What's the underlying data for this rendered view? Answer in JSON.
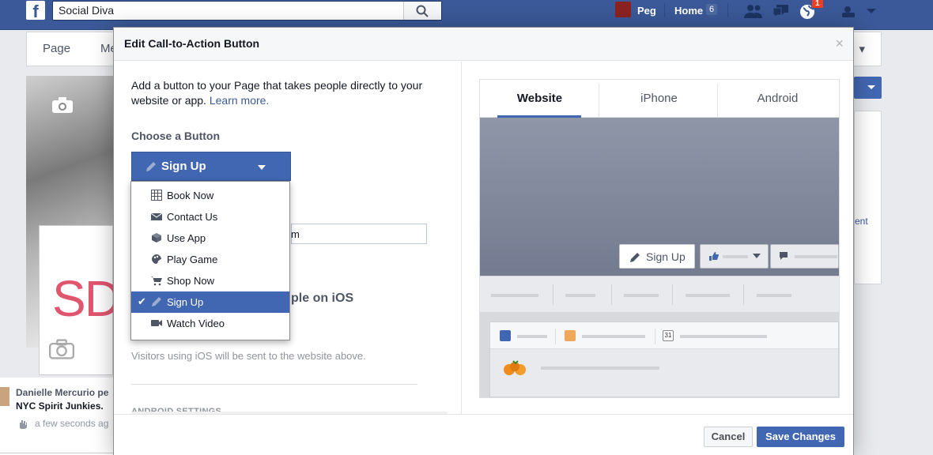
{
  "topbar": {
    "logo": "f",
    "search_value": "Social Diva",
    "user_name": "Peg",
    "home_label": "Home",
    "home_count": "6",
    "notification_count": "1"
  },
  "background": {
    "page_tab": "Page",
    "second_tab": "Me",
    "sd_text": "SD",
    "story_name": "Danielle Mercurio pe",
    "story_group": "NYC Spirit Junkies.",
    "story_time": "a few seconds ag",
    "right_k": "k",
    "right_ent": "ent"
  },
  "modal": {
    "title": "Edit Call-to-Action Button",
    "close": "×",
    "intro": "Add a button to your Page that takes people directly to your website or app.",
    "learn_more": "Learn more.",
    "choose_label": "Choose a Button",
    "selected_button": "Sign Up",
    "website_value_fragment": "m",
    "ios_heading_fragment": "ple on iOS",
    "ios_note": "Visitors using iOS will be sent to the website above.",
    "android_heading": "ANDROID SETTINGS",
    "cancel": "Cancel",
    "save": "Save Changes"
  },
  "menu": {
    "items": [
      {
        "label": "Book Now",
        "icon": "calendar-grid-icon"
      },
      {
        "label": "Contact Us",
        "icon": "envelope-icon"
      },
      {
        "label": "Use App",
        "icon": "cube-icon"
      },
      {
        "label": "Play Game",
        "icon": "gamepad-icon"
      },
      {
        "label": "Shop Now",
        "icon": "cart-icon"
      },
      {
        "label": "Sign Up",
        "icon": "pencil-icon",
        "selected": true
      },
      {
        "label": "Watch Video",
        "icon": "video-camera-icon"
      }
    ]
  },
  "preview": {
    "tabs": [
      "Website",
      "iPhone",
      "Android"
    ],
    "active_tab": "Website",
    "cta_label": "Sign Up",
    "calendar_day": "31"
  },
  "colors": {
    "brand_blue": "#3b5998",
    "button_blue": "#4267b2",
    "link": "#3b5998"
  }
}
